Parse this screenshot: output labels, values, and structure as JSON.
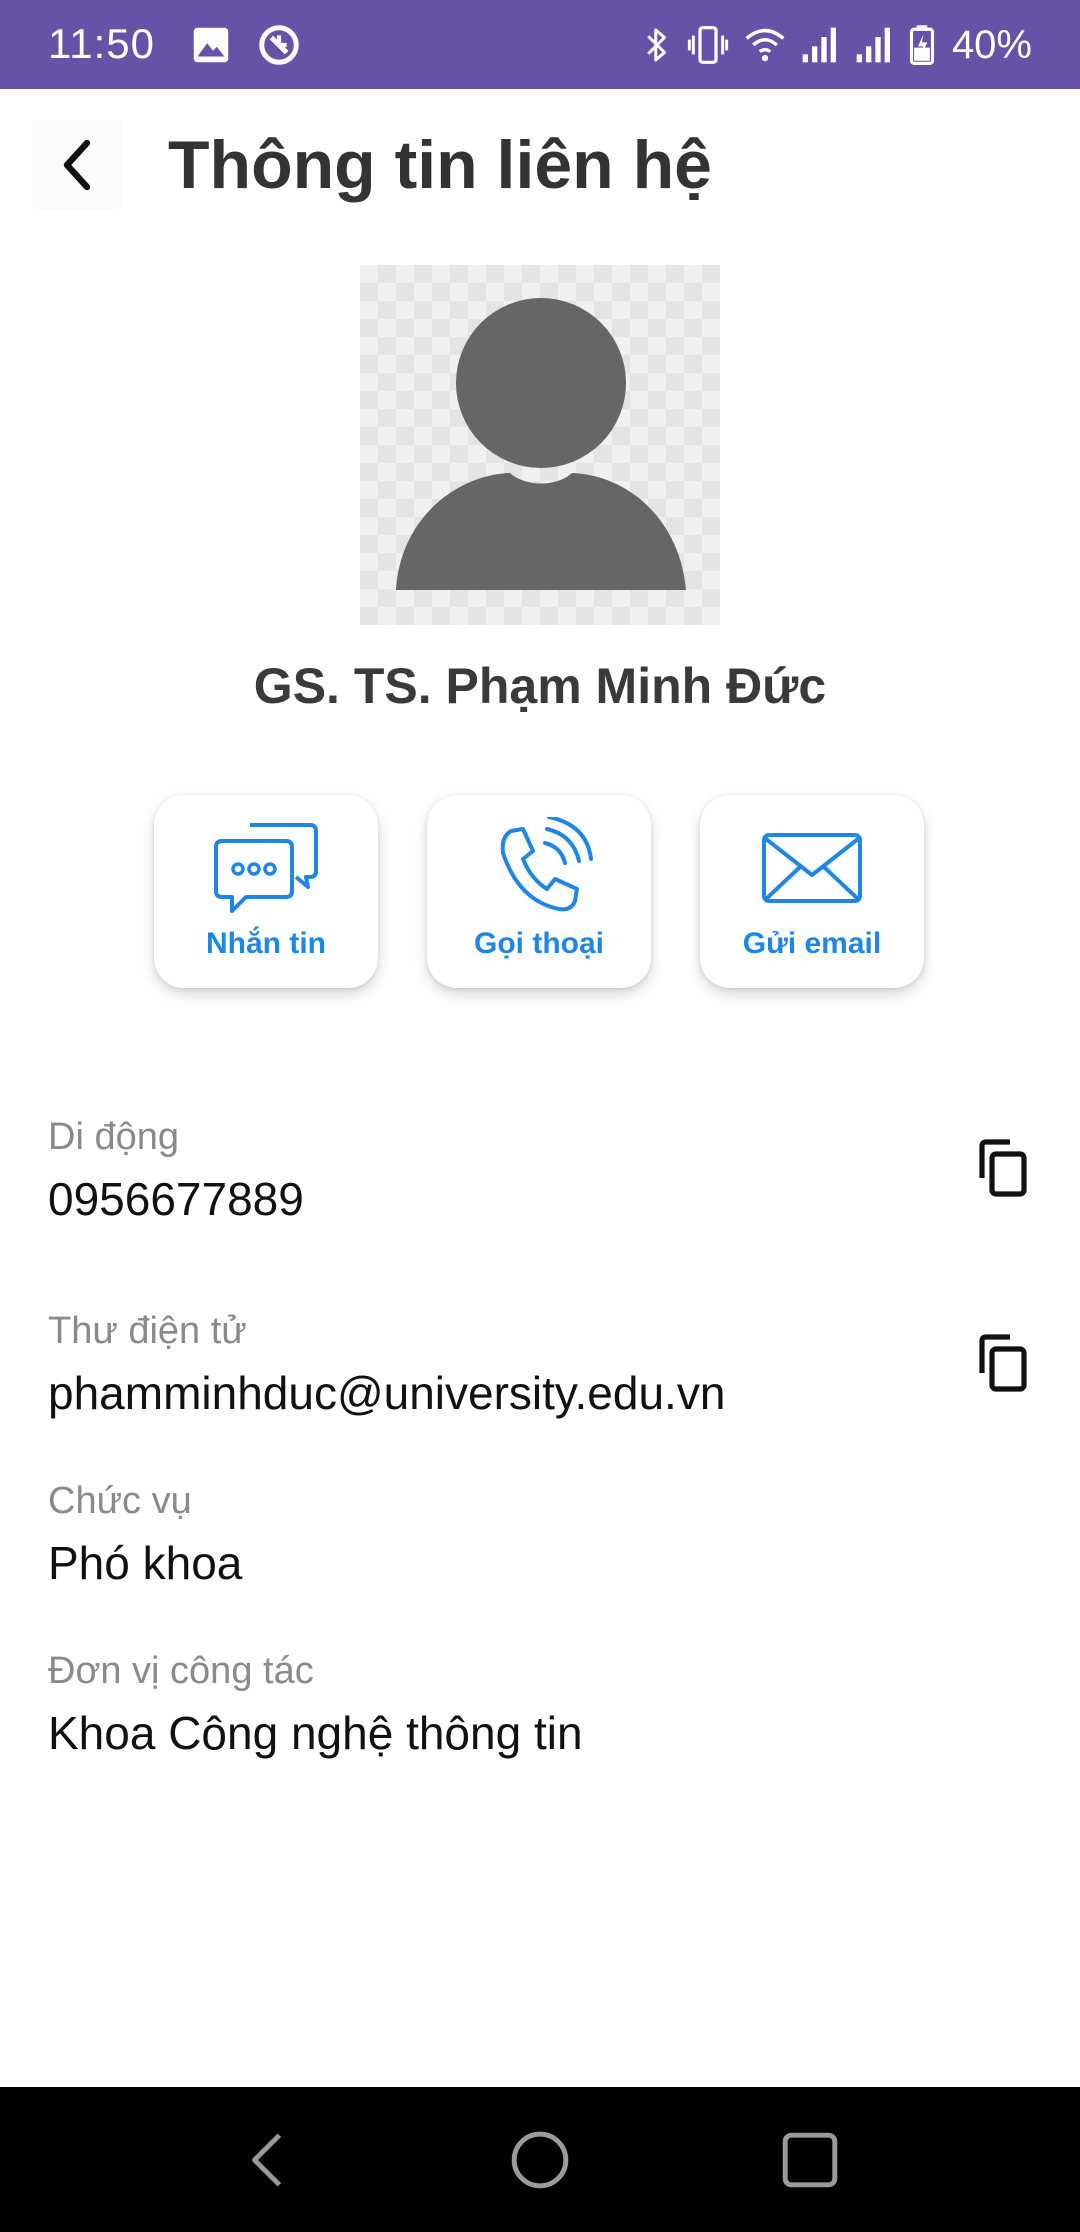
{
  "status_bar": {
    "time": "11:50",
    "battery_percent": "40%",
    "left_icons": [
      "gallery-icon",
      "data-saver-icon"
    ],
    "right_icons": [
      "bluetooth-icon",
      "vibrate-icon",
      "wifi-icon",
      "signal-icon",
      "signal-icon",
      "battery-icon"
    ],
    "background_color": "#6652a6"
  },
  "header": {
    "title": "Thông tin liên hệ",
    "back_icon": "chevron-left-icon"
  },
  "contact": {
    "name": "GS. TS. Phạm Minh Đức",
    "avatar_icon": "person-placeholder-icon"
  },
  "actions": [
    {
      "label": "Nhắn tin",
      "icon": "chat-bubbles-icon"
    },
    {
      "label": "Gọi thoại",
      "icon": "phone-call-icon"
    },
    {
      "label": "Gửi email",
      "icon": "envelope-icon"
    }
  ],
  "fields": [
    {
      "label": "Di động",
      "value": "0956677889",
      "copy_icon": "copy-icon"
    },
    {
      "label": "Thư điện tử",
      "value": "phamminhduc@university.edu.vn",
      "copy_icon": "copy-icon"
    },
    {
      "label": "Chức vụ",
      "value": "Phó khoa"
    },
    {
      "label": "Đơn vị công tác",
      "value": "Khoa Công nghệ thông tin"
    }
  ],
  "nav_bar": {
    "icons": [
      "nav-back-icon",
      "nav-home-icon",
      "nav-recents-icon"
    ]
  },
  "colors": {
    "accent": "#1f86e6",
    "title_text": "#333333",
    "label_text": "#8a8a8a"
  }
}
